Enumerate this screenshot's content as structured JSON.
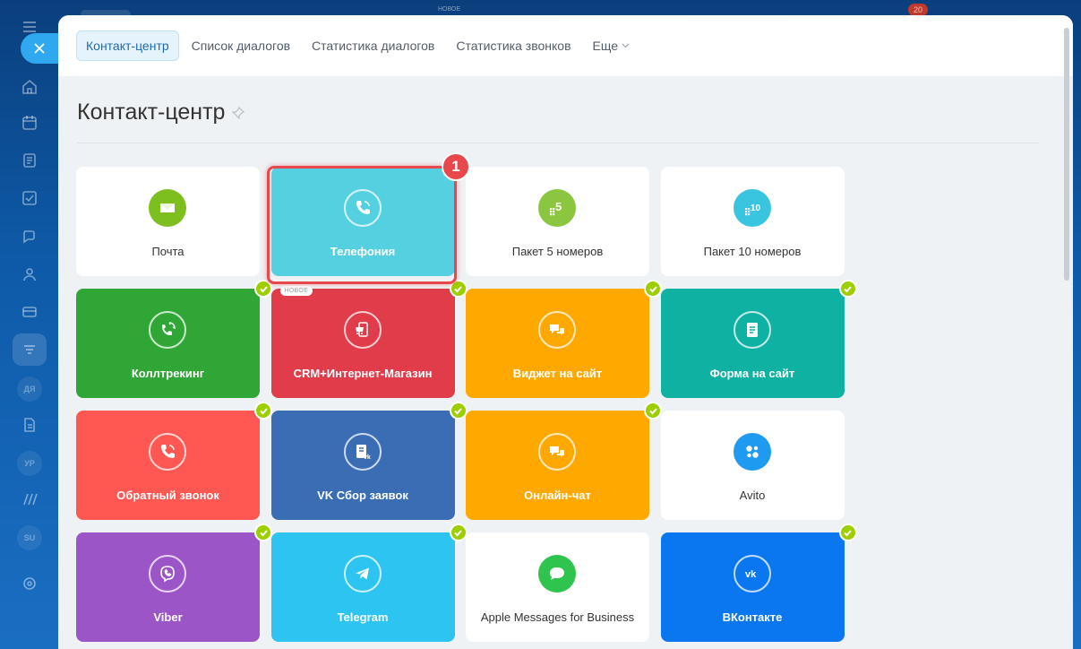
{
  "topstrip": {
    "new_label": "НОВОЕ",
    "badge_count": "20"
  },
  "tabs": [
    {
      "label": "Контакт-центр",
      "active": true
    },
    {
      "label": "Список диалогов"
    },
    {
      "label": "Статистика диалогов"
    },
    {
      "label": "Статистика звонков"
    },
    {
      "label": "Еще"
    }
  ],
  "page": {
    "title": "Контакт-центр"
  },
  "sidebar_avatars": [
    "ДЯ",
    "УР",
    "SU"
  ],
  "step_marker": "1",
  "tiles": [
    {
      "label": "Почта",
      "style": "white",
      "icon": "mail-icon",
      "icon_color": "#7cbf1e",
      "connected": false
    },
    {
      "label": "Телефония",
      "style": "colored",
      "bg": "#55d0e0",
      "icon": "phone-icon",
      "connected": true,
      "highlighted": true
    },
    {
      "label": "Пакет 5 номеров",
      "style": "white",
      "icon": "numbers-5-icon",
      "icon_color": "#8cc63f",
      "icon_text": "5",
      "connected": false
    },
    {
      "label": "Пакет 10 номеров",
      "style": "white",
      "icon": "numbers-10-icon",
      "icon_color": "#39c5e0",
      "icon_text": "10",
      "connected": false
    },
    {
      "label": "Коллтрекинг",
      "style": "colored",
      "bg": "#2fa636",
      "icon": "calltracking-icon",
      "connected": true
    },
    {
      "label": "CRM+Интернет-Магазин",
      "style": "colored",
      "bg": "#e03c49",
      "icon": "shop-icon",
      "connected": true,
      "badge": "НОВОЕ"
    },
    {
      "label": "Виджет на сайт",
      "style": "colored",
      "bg": "#ffa900",
      "icon": "chat-icon",
      "connected": true
    },
    {
      "label": "Форма на сайт",
      "style": "colored",
      "bg": "#0fb1a2",
      "icon": "form-icon",
      "connected": true
    },
    {
      "label": "Обратный звонок",
      "style": "colored",
      "bg": "#ff5752",
      "icon": "callback-icon",
      "connected": true
    },
    {
      "label": "VK Сбор заявок",
      "style": "colored",
      "bg": "#3a6db4",
      "icon": "vk-leads-icon",
      "connected": true
    },
    {
      "label": "Онлайн-чат",
      "style": "colored",
      "bg": "#ffa900",
      "icon": "chat-icon",
      "connected": true
    },
    {
      "label": "Avito",
      "style": "white",
      "icon": "avito-icon",
      "icon_color": "#1e9bf0",
      "connected": false
    },
    {
      "label": "Viber",
      "style": "colored",
      "bg": "#9b55c7",
      "icon": "viber-icon",
      "connected": true
    },
    {
      "label": "Telegram",
      "style": "colored",
      "bg": "#2ec4f2",
      "icon": "telegram-icon",
      "connected": true
    },
    {
      "label": "Apple Messages for Business",
      "style": "white",
      "icon": "apple-messages-icon",
      "icon_color": "#2fc44e",
      "connected": false
    },
    {
      "label": "ВКонтакте",
      "style": "colored",
      "bg": "#0a77f0",
      "icon": "vk-icon",
      "connected": true
    }
  ]
}
